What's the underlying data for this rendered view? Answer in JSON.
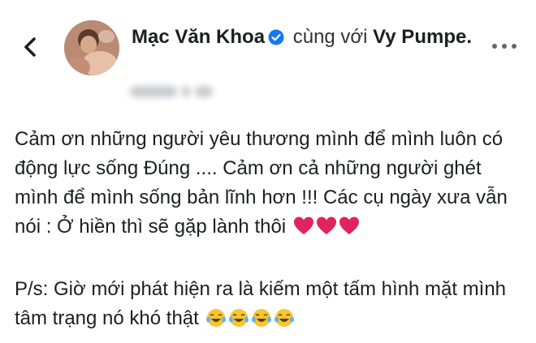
{
  "header": {
    "author": "Mạc Văn Khoa",
    "with_text": "cùng với",
    "tagged": "Vy Pumpe."
  },
  "post": {
    "para1": "Cảm ơn những người yêu thương mình để mình luôn có động lực sống Đúng .... Cảm ơn cả những người ghét mình để mình sống bản lĩnh hơn !!! Các cụ ngày xưa vẫn nói :  Ở hiền thì sẽ gặp lành thôi",
    "para2": "P/s: Giờ mới phát hiện ra là kiếm một tấm hình mặt mình tâm trạng nó khó thật"
  },
  "icons": {
    "back": "chevron-left-icon",
    "verified": "verified-badge-icon",
    "more": "more-options-icon",
    "heart": "red-heart-emoji",
    "laugh": "laughing-tears-emoji"
  },
  "colors": {
    "verified_blue": "#1877f2",
    "heart_red": "#e0245e",
    "emoji_yellow": "#f7c531"
  }
}
